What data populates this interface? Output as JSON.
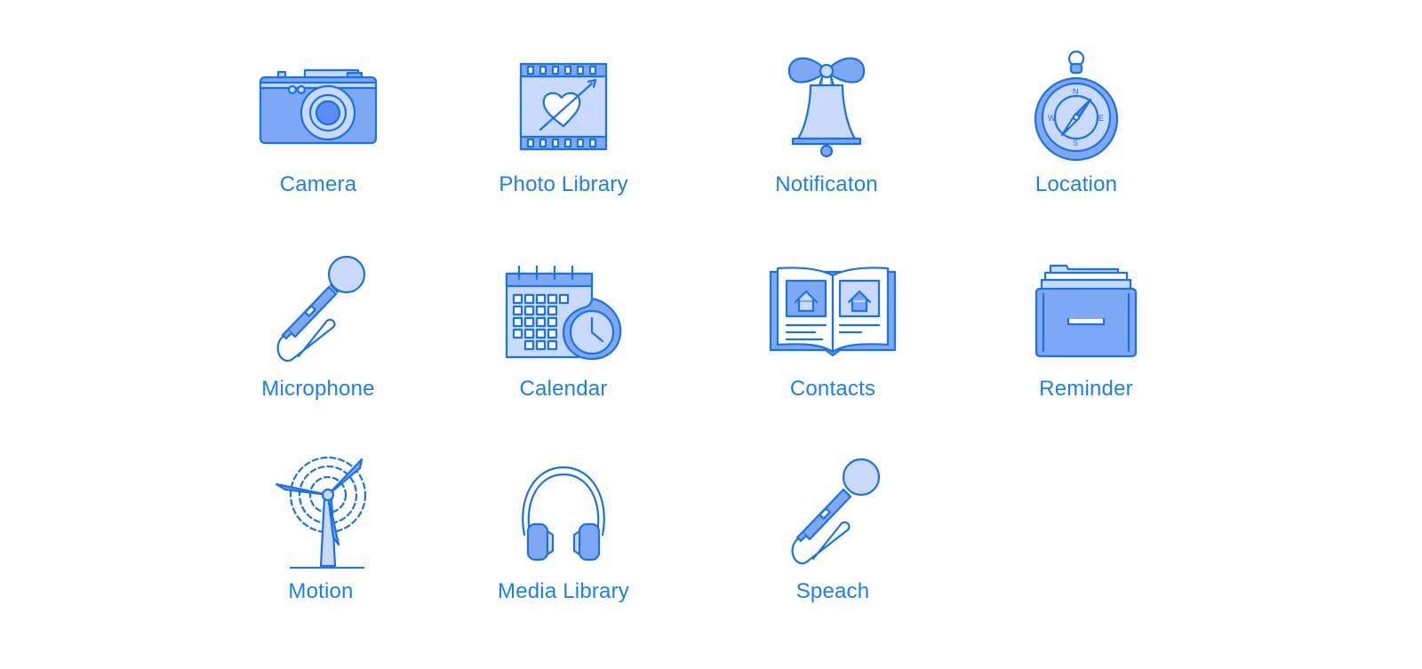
{
  "colors": {
    "accent": "#1a80f0",
    "icon_stroke": "#1a72e6",
    "icon_fill_mid": "#7ea8f3",
    "icon_fill_light": "#c9dafb",
    "background": "#ffffff"
  },
  "permissions": [
    {
      "id": "camera",
      "label": "Camera",
      "icon": "camera-icon"
    },
    {
      "id": "photo-library",
      "label": "Photo Library",
      "icon": "film-heart-icon"
    },
    {
      "id": "notification",
      "label": "Notificaton",
      "icon": "bell-icon"
    },
    {
      "id": "location",
      "label": "Location",
      "icon": "compass-icon"
    },
    {
      "id": "microphone",
      "label": "Microphone",
      "icon": "microphone-icon"
    },
    {
      "id": "calendar",
      "label": "Calendar",
      "icon": "calendar-clock-icon"
    },
    {
      "id": "contacts",
      "label": "Contacts",
      "icon": "open-book-icon"
    },
    {
      "id": "reminder",
      "label": "Reminder",
      "icon": "file-drawer-icon"
    },
    {
      "id": "motion",
      "label": "Motion",
      "icon": "wind-turbine-icon"
    },
    {
      "id": "media-library",
      "label": "Media Library",
      "icon": "headphones-icon"
    },
    {
      "id": "speech",
      "label": "Speach",
      "icon": "microphone-icon"
    }
  ]
}
